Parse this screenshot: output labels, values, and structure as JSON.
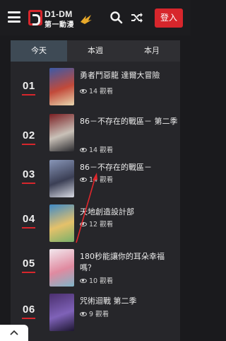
{
  "header": {
    "logo_top": "D1-DM",
    "logo_bottom": "第一動漫",
    "login_label": "登入"
  },
  "tabs": [
    {
      "label": "今天",
      "active": true
    },
    {
      "label": "本週",
      "active": false
    },
    {
      "label": "本月",
      "active": false
    }
  ],
  "items": [
    {
      "rank": "01",
      "title": "勇者鬥惡龍 達爾大冒險",
      "views": "14 觀看",
      "colors": [
        "#3b5aa8",
        "#c24a3a",
        "#e8d8b0"
      ]
    },
    {
      "rank": "02",
      "title": "86－不存在的戰區－ 第二季",
      "views": "14 觀看",
      "colors": [
        "#7a1e22",
        "#c9c1b8",
        "#2a2a2e"
      ]
    },
    {
      "rank": "03",
      "title": "86－不存在的戰區－",
      "views": "14 觀看",
      "colors": [
        "#8896b8",
        "#3b3f55",
        "#d9dbe4"
      ]
    },
    {
      "rank": "04",
      "title": "天地創造設計部",
      "views": "12 觀看",
      "colors": [
        "#3f8ac7",
        "#e5c16a",
        "#78b06a"
      ]
    },
    {
      "rank": "05",
      "title": "180秒能讓你的耳朵幸福嗎？",
      "views": "10 觀看",
      "colors": [
        "#f2e8ee",
        "#e08aa0",
        "#7fb5c8"
      ]
    },
    {
      "rank": "06",
      "title": "咒術迴戰 第二季",
      "views": "9 觀看",
      "colors": [
        "#4a2f6e",
        "#7f62b8",
        "#1d1630"
      ]
    }
  ],
  "colors": {
    "accent": "#d7262c",
    "annotation_arrow": "#e0262c"
  }
}
